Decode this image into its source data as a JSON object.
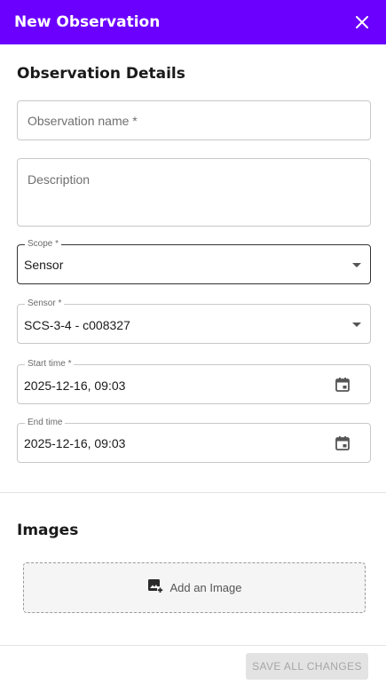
{
  "header": {
    "title": "New Observation",
    "close_icon": "close-icon"
  },
  "details": {
    "title": "Observation Details"
  },
  "fields": {
    "name": {
      "placeholder": "Observation name *"
    },
    "description": {
      "placeholder": "Description"
    },
    "scope": {
      "label": "Scope *",
      "value": "Sensor"
    },
    "sensor": {
      "label": "Sensor *",
      "value": "SCS-3-4 - c008327"
    },
    "start": {
      "label": "Start time *",
      "value": "2025-12-16, 09:03"
    },
    "end": {
      "label": "End time",
      "value": "2025-12-16, 09:03"
    }
  },
  "images": {
    "title": "Images",
    "add_label": "Add an Image"
  },
  "footer": {
    "save_label": "SAVE ALL CHANGES"
  },
  "colors": {
    "header_bg": "#6b00ff",
    "button_disabled": "#e3e3e3"
  }
}
